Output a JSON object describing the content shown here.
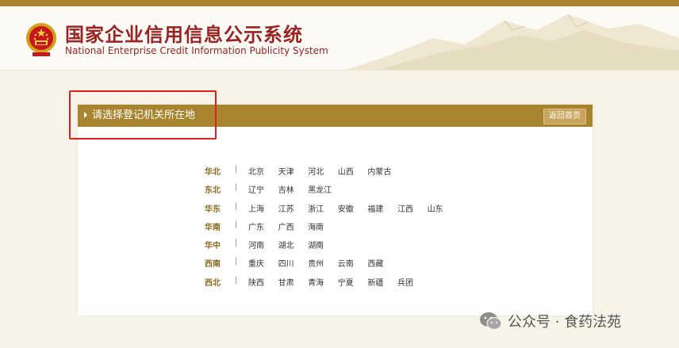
{
  "header": {
    "title_cn": "国家企业信用信息公示系统",
    "title_en": "National Enterprise Credit Information Publicity System"
  },
  "panel": {
    "title": "请选择登记机关所在地",
    "back_label": "返回首页"
  },
  "regions": [
    {
      "name": "华北",
      "provinces": [
        "北京",
        "天津",
        "河北",
        "山西",
        "内蒙古"
      ]
    },
    {
      "name": "东北",
      "provinces": [
        "辽宁",
        "吉林",
        "黑龙江"
      ]
    },
    {
      "name": "华东",
      "provinces": [
        "上海",
        "江苏",
        "浙江",
        "安徽",
        "福建",
        "江西",
        "山东"
      ]
    },
    {
      "name": "华南",
      "provinces": [
        "广东",
        "广西",
        "海南"
      ]
    },
    {
      "name": "华中",
      "provinces": [
        "河南",
        "湖北",
        "湖南"
      ]
    },
    {
      "name": "西南",
      "provinces": [
        "重庆",
        "四川",
        "贵州",
        "云南",
        "西藏"
      ]
    },
    {
      "name": "西北",
      "provinces": [
        "陕西",
        "甘肃",
        "青海",
        "宁夏",
        "新疆",
        "兵团"
      ]
    }
  ],
  "separator": "|",
  "watermark": "公众号 · 食药法苑",
  "colors": {
    "accent": "#a8842e",
    "title_red": "#9a2222",
    "highlight": "#e02020"
  },
  "icons": [
    "national-emblem-icon",
    "wechat-icon"
  ]
}
